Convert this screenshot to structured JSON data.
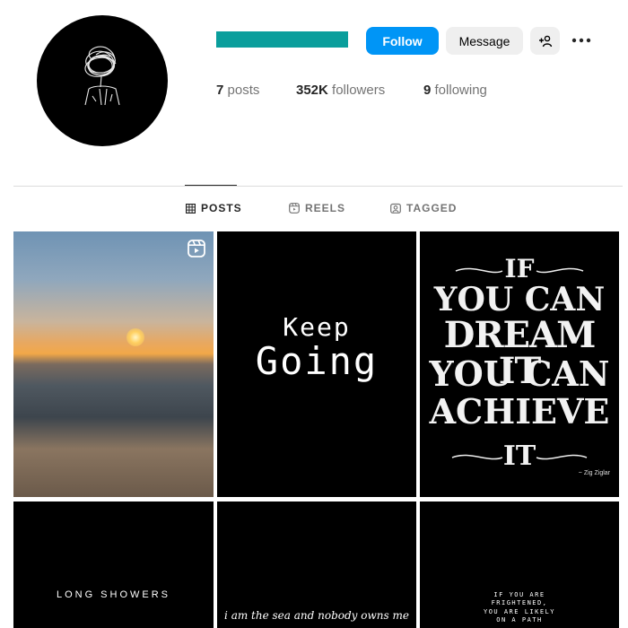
{
  "profile": {
    "username_color": "#0a9e9c",
    "follow_label": "Follow",
    "message_label": "Message",
    "add_user_label": "+⎇",
    "more_icon": "more-horizontal-icon",
    "stats": {
      "posts_count": "7",
      "posts_label": "posts",
      "followers_count": "352K",
      "followers_label": "followers",
      "following_count": "9",
      "following_label": "following"
    }
  },
  "tabs": [
    {
      "label": "POSTS",
      "icon": "grid-icon",
      "active": true
    },
    {
      "label": "REELS",
      "icon": "reels-icon",
      "active": false
    },
    {
      "label": "TAGGED",
      "icon": "tagged-icon",
      "active": false
    }
  ],
  "posts": [
    {
      "type": "reel",
      "icon": "reel-icon"
    },
    {
      "line1": "Keep",
      "line2": "Going"
    },
    {
      "lines": [
        "IF",
        "YOU CAN",
        "DREAM IT",
        "YOU CAN",
        "ACHIEVE",
        "IT"
      ],
      "attribution": "~ Zig Ziglar"
    },
    {
      "text": "LONG SHOWERS"
    },
    {
      "text": "i am the sea and nobody owns me"
    },
    {
      "lines": [
        "IF YOU ARE",
        "FRIGHTENED,",
        "YOU ARE LIKELY",
        "ON A PATH"
      ]
    }
  ],
  "colors": {
    "accent": "#0095f6",
    "secondary_button": "#efefef",
    "divider": "#dbdbdb",
    "muted_text": "#737373"
  }
}
